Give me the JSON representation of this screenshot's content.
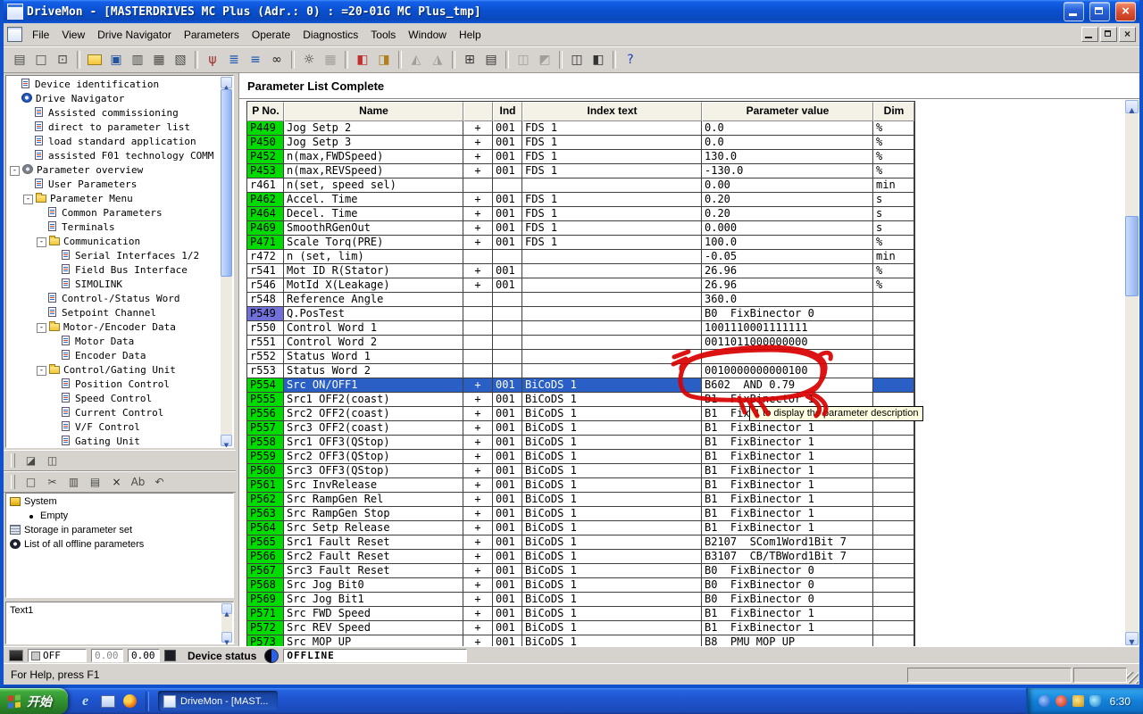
{
  "colors": {
    "param_green": "#00DC00",
    "bico_blue": "#7070D8",
    "selection_blue": "#2A5FC6",
    "annotation_red": "#D90000",
    "tooltip_bg": "#FFFFE1"
  },
  "window": {
    "title": "DriveMon - [MASTERDRIVES MC Plus  (Adr.: 0) : =20-01G MC Plus_tmp]"
  },
  "menu": {
    "items": [
      "File",
      "View",
      "Drive Navigator",
      "Parameters",
      "Operate",
      "Diagnostics",
      "Tools",
      "Window",
      "Help"
    ]
  },
  "main_toolbar": {
    "buttons": [
      {
        "n": "paste",
        "g": "▤"
      },
      {
        "n": "new-document",
        "g": "□"
      },
      {
        "n": "open-document",
        "g": "⊡"
      },
      {
        "sep": true
      },
      {
        "n": "open-folder",
        "g": "",
        "cls": "folder"
      },
      {
        "n": "save",
        "g": "▣",
        "fg": "#23549D"
      },
      {
        "n": "copy-document",
        "g": "▥"
      },
      {
        "n": "print",
        "g": "▦"
      },
      {
        "n": "print-preview",
        "g": "▧"
      },
      {
        "sep": true
      },
      {
        "n": "connect-drive",
        "g": "ψ",
        "fg": "#A03028"
      },
      {
        "n": "drive-view-list",
        "g": "≣",
        "fg": "#1C55B0"
      },
      {
        "n": "drive-view-tree",
        "g": "≡",
        "fg": "#1C55B0"
      },
      {
        "n": "search-binoculars",
        "g": "∞",
        "fg": "#222222"
      },
      {
        "sep": true
      },
      {
        "n": "settings-gear",
        "g": "☼",
        "fg": "#333333"
      },
      {
        "n": "parameter-grid",
        "g": "▦",
        "dis": true
      },
      {
        "sep": true
      },
      {
        "n": "compare-parameters",
        "g": "◧",
        "fg": "#C03030"
      },
      {
        "n": "convert-parameters",
        "g": "◨",
        "fg": "#B08020"
      },
      {
        "sep": true
      },
      {
        "n": "upload",
        "g": "◭",
        "dis": true
      },
      {
        "n": "download",
        "g": "◮",
        "dis": true
      },
      {
        "sep": true
      },
      {
        "n": "parameter-table",
        "g": "⊞",
        "fg": "#333333"
      },
      {
        "n": "parameter-form",
        "g": "▤",
        "fg": "#333333"
      },
      {
        "sep": true
      },
      {
        "n": "monitor-1",
        "g": "◫",
        "dis": true
      },
      {
        "n": "monitor-2",
        "g": "◩",
        "dis": true
      },
      {
        "sep": true
      },
      {
        "n": "window-tile",
        "g": "◫",
        "fg": "#333333"
      },
      {
        "n": "window-cascade",
        "g": "◧",
        "fg": "#333333"
      },
      {
        "sep": true
      },
      {
        "n": "help",
        "g": "?",
        "fg": "#1A3FBF"
      }
    ]
  },
  "left_toolbars": {
    "row1": [
      {
        "n": "dock-window",
        "g": "◪"
      },
      {
        "n": "link-window",
        "g": "◫"
      }
    ],
    "row2": [
      {
        "n": "new-item",
        "g": "□"
      },
      {
        "n": "cut",
        "g": "✂"
      },
      {
        "n": "copy",
        "g": "▥"
      },
      {
        "n": "paste",
        "g": "▤"
      },
      {
        "n": "delete",
        "g": "×",
        "fg": "#202020"
      },
      {
        "n": "rename",
        "g": "Ab"
      },
      {
        "n": "undo",
        "g": "↶"
      }
    ]
  },
  "tree": {
    "items": [
      {
        "l": 0,
        "icon": "doc",
        "t": "Device identification"
      },
      {
        "l": 0,
        "icon": "wheel",
        "t": "Drive Navigator"
      },
      {
        "l": 1,
        "icon": "doc",
        "t": "Assisted commissioning"
      },
      {
        "l": 1,
        "icon": "doc",
        "t": "direct to parameter list"
      },
      {
        "l": 1,
        "icon": "doc",
        "t": "load standard application"
      },
      {
        "l": 1,
        "icon": "doc",
        "t": "assisted F01 technology COMM"
      },
      {
        "l": 0,
        "icon": "gear",
        "t": "Parameter overview",
        "exp": "-"
      },
      {
        "l": 1,
        "icon": "doc",
        "t": "User Parameters"
      },
      {
        "l": 1,
        "icon": "folder",
        "t": "Parameter Menu",
        "exp": "-"
      },
      {
        "l": 2,
        "icon": "doc",
        "t": "Common Parameters"
      },
      {
        "l": 2,
        "icon": "doc",
        "t": "Terminals"
      },
      {
        "l": 2,
        "icon": "folder",
        "t": "Communication",
        "exp": "-"
      },
      {
        "l": 3,
        "icon": "doc",
        "t": "Serial Interfaces 1/2"
      },
      {
        "l": 3,
        "icon": "doc",
        "t": "Field Bus Interface"
      },
      {
        "l": 3,
        "icon": "doc",
        "t": "SIMOLINK"
      },
      {
        "l": 2,
        "icon": "doc",
        "t": "Control-/Status Word"
      },
      {
        "l": 2,
        "icon": "doc",
        "t": "Setpoint Channel"
      },
      {
        "l": 2,
        "icon": "folder",
        "t": "Motor-/Encoder Data",
        "exp": "-"
      },
      {
        "l": 3,
        "icon": "doc",
        "t": "Motor Data"
      },
      {
        "l": 3,
        "icon": "doc",
        "t": "Encoder Data"
      },
      {
        "l": 2,
        "icon": "folder",
        "t": "Control/Gating Unit",
        "exp": "-"
      },
      {
        "l": 3,
        "icon": "doc",
        "t": "Position Control"
      },
      {
        "l": 3,
        "icon": "doc",
        "t": "Speed Control"
      },
      {
        "l": 3,
        "icon": "doc",
        "t": "Current Control"
      },
      {
        "l": 3,
        "icon": "doc",
        "t": "V/F Control"
      },
      {
        "l": 3,
        "icon": "doc",
        "t": "Gating Unit"
      }
    ]
  },
  "system_panel": {
    "items": [
      {
        "icon": "sysbox",
        "t": "System"
      },
      {
        "icon": "bullet",
        "t": "Empty"
      },
      {
        "icon": "storage",
        "t": "Storage in parameter set"
      },
      {
        "icon": "offline",
        "t": "List of all offline parameters"
      }
    ]
  },
  "text1": {
    "label": "Text1"
  },
  "param_list": {
    "title": "Parameter List Complete",
    "columns": [
      "P No.",
      "Name",
      "",
      "Ind",
      "Index text",
      "Parameter value",
      "Dim"
    ],
    "rows": [
      {
        "pno": "P449",
        "c": "g",
        "name": "Jog Setp 2",
        "plus": true,
        "ind": "001",
        "itext": "FDS 1",
        "val": "0.0",
        "dim": "%"
      },
      {
        "pno": "P450",
        "c": "g",
        "name": "Jog Setp 3",
        "plus": true,
        "ind": "001",
        "itext": "FDS 1",
        "val": "0.0",
        "dim": "%"
      },
      {
        "pno": "P452",
        "c": "g",
        "name": "n(max,FWDSpeed)",
        "plus": true,
        "ind": "001",
        "itext": "FDS 1",
        "val": "130.0",
        "dim": "%"
      },
      {
        "pno": "P453",
        "c": "g",
        "name": "n(max,REVSpeed)",
        "plus": true,
        "ind": "001",
        "itext": "FDS 1",
        "val": "-130.0",
        "dim": "%"
      },
      {
        "pno": "r461",
        "c": "w",
        "name": "n(set, speed sel)",
        "val": "0.00",
        "dim": "min"
      },
      {
        "pno": "P462",
        "c": "g",
        "name": "Accel. Time",
        "plus": true,
        "ind": "001",
        "itext": "FDS 1",
        "val": "0.20",
        "dim": "s"
      },
      {
        "pno": "P464",
        "c": "g",
        "name": "Decel. Time",
        "plus": true,
        "ind": "001",
        "itext": "FDS 1",
        "val": "0.20",
        "dim": "s"
      },
      {
        "pno": "P469",
        "c": "g",
        "name": "SmoothRGenOut",
        "plus": true,
        "ind": "001",
        "itext": "FDS 1",
        "val": "0.000",
        "dim": "s"
      },
      {
        "pno": "P471",
        "c": "g",
        "name": "Scale Torq(PRE)",
        "plus": true,
        "ind": "001",
        "itext": "FDS 1",
        "val": "100.0",
        "dim": "%"
      },
      {
        "pno": "r472",
        "c": "w",
        "name": "n (set, lim)",
        "val": "-0.05",
        "dim": "min"
      },
      {
        "pno": "r541",
        "c": "w",
        "name": "Mot ID R(Stator)",
        "plus": true,
        "ind": "001",
        "val": "26.96",
        "dim": "%"
      },
      {
        "pno": "r546",
        "c": "w",
        "name": "MotId X(Leakage)",
        "plus": true,
        "ind": "001",
        "val": "26.96",
        "dim": "%"
      },
      {
        "pno": "r548",
        "c": "w",
        "name": "Reference Angle",
        "val": "360.0"
      },
      {
        "pno": "P549",
        "c": "b",
        "name": "Q.PosTest",
        "val": "B0  FixBinector 0"
      },
      {
        "pno": "r550",
        "c": "w",
        "name": "Control Word 1",
        "val": "1001110001111111"
      },
      {
        "pno": "r551",
        "c": "w",
        "name": "Control Word 2",
        "val": "0011011000000000"
      },
      {
        "pno": "r552",
        "c": "w",
        "name": "Status Word 1",
        "val": ""
      },
      {
        "pno": "r553",
        "c": "w",
        "name": "Status Word 2",
        "val": "0010000000000100"
      },
      {
        "pno": "P554",
        "c": "g",
        "name": "Src ON/OFF1",
        "plus": true,
        "ind": "001",
        "itext": "BiCoDS 1",
        "val": "B602  AND 0.79",
        "selected": true
      },
      {
        "pno": "P555",
        "c": "g",
        "name": "Src1 OFF2(coast)",
        "plus": true,
        "ind": "001",
        "itext": "BiCoDS 1",
        "val": "B1  FixBinector 1"
      },
      {
        "pno": "P556",
        "c": "g",
        "name": "Src2 OFF2(coast)",
        "plus": true,
        "ind": "001",
        "itext": "BiCoDS 1",
        "val": "B1  FixBinector 1"
      },
      {
        "pno": "P557",
        "c": "g",
        "name": "Src3 OFF2(coast)",
        "plus": true,
        "ind": "001",
        "itext": "BiCoDS 1",
        "val": "B1  FixBinector 1"
      },
      {
        "pno": "P558",
        "c": "g",
        "name": "Src1 OFF3(QStop)",
        "plus": true,
        "ind": "001",
        "itext": "BiCoDS 1",
        "val": "B1  FixBinector 1"
      },
      {
        "pno": "P559",
        "c": "g",
        "name": "Src2 OFF3(QStop)",
        "plus": true,
        "ind": "001",
        "itext": "BiCoDS 1",
        "val": "B1  FixBinector 1"
      },
      {
        "pno": "P560",
        "c": "g",
        "name": "Src3 OFF3(QStop)",
        "plus": true,
        "ind": "001",
        "itext": "BiCoDS 1",
        "val": "B1  FixBinector 1"
      },
      {
        "pno": "P561",
        "c": "g",
        "name": "Src InvRelease",
        "plus": true,
        "ind": "001",
        "itext": "BiCoDS 1",
        "val": "B1  FixBinector 1"
      },
      {
        "pno": "P562",
        "c": "g",
        "name": "Src RampGen Rel",
        "plus": true,
        "ind": "001",
        "itext": "BiCoDS 1",
        "val": "B1  FixBinector 1"
      },
      {
        "pno": "P563",
        "c": "g",
        "name": "Src RampGen Stop",
        "plus": true,
        "ind": "001",
        "itext": "BiCoDS 1",
        "val": "B1  FixBinector 1"
      },
      {
        "pno": "P564",
        "c": "g",
        "name": "Src Setp Release",
        "plus": true,
        "ind": "001",
        "itext": "BiCoDS 1",
        "val": "B1  FixBinector 1"
      },
      {
        "pno": "P565",
        "c": "g",
        "name": "Src1 Fault Reset",
        "plus": true,
        "ind": "001",
        "itext": "BiCoDS 1",
        "val": "B2107  SCom1Word1Bit 7"
      },
      {
        "pno": "P566",
        "c": "g",
        "name": "Src2 Fault Reset",
        "plus": true,
        "ind": "001",
        "itext": "BiCoDS 1",
        "val": "B3107  CB/TBWord1Bit 7"
      },
      {
        "pno": "P567",
        "c": "g",
        "name": "Src3 Fault Reset",
        "plus": true,
        "ind": "001",
        "itext": "BiCoDS 1",
        "val": "B0  FixBinector 0"
      },
      {
        "pno": "P568",
        "c": "g",
        "name": "Src Jog Bit0",
        "plus": true,
        "ind": "001",
        "itext": "BiCoDS 1",
        "val": "B0  FixBinector 0"
      },
      {
        "pno": "P569",
        "c": "g",
        "name": "Src Jog Bit1",
        "plus": true,
        "ind": "001",
        "itext": "BiCoDS 1",
        "val": "B0  FixBinector 0"
      },
      {
        "pno": "P571",
        "c": "g",
        "name": "Src FWD Speed",
        "plus": true,
        "ind": "001",
        "itext": "BiCoDS 1",
        "val": "B1  FixBinector 1"
      },
      {
        "pno": "P572",
        "c": "g",
        "name": "Src REV Speed",
        "plus": true,
        "ind": "001",
        "itext": "BiCoDS 1",
        "val": "B1  FixBinector 1"
      },
      {
        "pno": "P573",
        "c": "g",
        "name": "Src MOP UP",
        "plus": true,
        "ind": "001",
        "itext": "BiCoDS 1",
        "val": "B8  PMU MOP UP"
      }
    ]
  },
  "annotation": {
    "tooltip": "1 to display the parameter description"
  },
  "bottom_bar": {
    "off": "OFF",
    "val1": "0.00",
    "val2": "0.00",
    "device_status": "Device status",
    "line_status": "OFFLINE"
  },
  "status_bar": {
    "help": "For Help, press F1"
  },
  "taskbar": {
    "start": "开始",
    "task": "DriveMon - [MAST...",
    "time": "6:30"
  }
}
